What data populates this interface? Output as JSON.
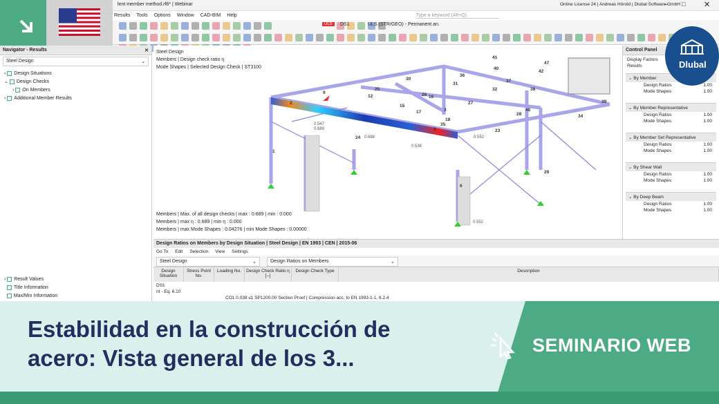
{
  "window": {
    "title": "lent member method.rf6* | Webinar",
    "license": "Online License 24 | Andreas Hörold | Dlubal Software GmbH",
    "search_placeholder": "Type a keyword (Alt+Q)"
  },
  "menu": [
    "Results",
    "Tools",
    "Options",
    "Window",
    "CAD-BIM",
    "Help"
  ],
  "toolbar": {
    "ds": "DS1",
    "combo": "ULS (STR/GEO) - Permanent an...",
    "uls": "ULS"
  },
  "nav": {
    "header": "Navigator - Results",
    "selector": "Steel Design",
    "items": [
      "Design Situations",
      "Design Checks",
      "On Members",
      "Additional Member Results"
    ],
    "bottom_items": [
      "Result Values",
      "Title Information",
      "Max/Min Information"
    ]
  },
  "view": {
    "lines": [
      "Steel Design",
      "Members | Design check ratio η",
      "Mode Shapes | Selected Design Check | ST3100"
    ],
    "footer_lines": [
      "Members | Max. of all design checks | max : 0.689 | min : 0.000",
      "Members | max η : 0.689 | min η : 0.000",
      "Members | max Mode Shapes : 0.04276 | min Mode Shapes : 0.00000"
    ],
    "member_labels": [
      "1",
      "2",
      "3",
      "5",
      "6",
      "9",
      "12",
      "15",
      "16",
      "17",
      "18",
      "23",
      "24",
      "25",
      "26",
      "27",
      "28",
      "29",
      "30",
      "31",
      "32",
      "34",
      "35",
      "36",
      "37",
      "38",
      "39",
      "40",
      "41",
      "42",
      "46",
      "47"
    ],
    "value_labels": [
      "0.552",
      "0.552",
      "0.689",
      "0.688",
      "0.547",
      "0.538"
    ]
  },
  "control_panel": {
    "header": "Control Panel",
    "sub": [
      "Display Factors",
      "Results"
    ],
    "sections": [
      {
        "name": "By Member",
        "rows": [
          [
            "Design Ratios",
            "1.00"
          ],
          [
            "Mode Shapes",
            "1.00"
          ]
        ]
      },
      {
        "name": "By Member Representative",
        "rows": [
          [
            "Design Ratios",
            "1.00"
          ],
          [
            "Mode Shapes",
            "1.00"
          ]
        ]
      },
      {
        "name": "By Member Set Representative",
        "rows": [
          [
            "Design Ratios",
            "1.00"
          ],
          [
            "Mode Shapes",
            "1.00"
          ]
        ]
      },
      {
        "name": "By Shear Wall",
        "rows": [
          [
            "Design Ratios",
            "1.00"
          ],
          [
            "Mode Shapes",
            "1.00"
          ]
        ]
      },
      {
        "name": "By Deep Beam",
        "rows": [
          [
            "Design Ratios",
            "1.00"
          ],
          [
            "Mode Shapes",
            "1.00"
          ]
        ]
      }
    ]
  },
  "results": {
    "header": "Design Ratios on Members by Design Situation | Steel Design | EN 1993 | CEN | 2015-06",
    "menu": [
      "Go To",
      "Edit",
      "Selection",
      "View",
      "Settings"
    ],
    "selector1": "Steel Design",
    "selector2": "Design Ratios on Members",
    "columns": [
      "Design Situation",
      "Stress Point No.",
      "Loading No.",
      "Design Check Ratio η [--]",
      "Design Check Type",
      "Description"
    ],
    "row1": "DS1",
    "row2": "nt - Eq. 6.10",
    "row3": "CO1    0.038 ≤1    SP1200.00   Section Proof | Compression acc. to EN 1993-1-1, 6.2.4"
  },
  "banner": {
    "title": "Estabilidad en la construcción de acero: Vista general de los 3...",
    "tag": "SEMINARIO WEB"
  },
  "logo": {
    "text": "Dlubal"
  },
  "colors": {
    "green": "#4cab84",
    "navy": "#1f2f5e",
    "light": "#d9f0ec",
    "steel": "#a8a5e8"
  }
}
